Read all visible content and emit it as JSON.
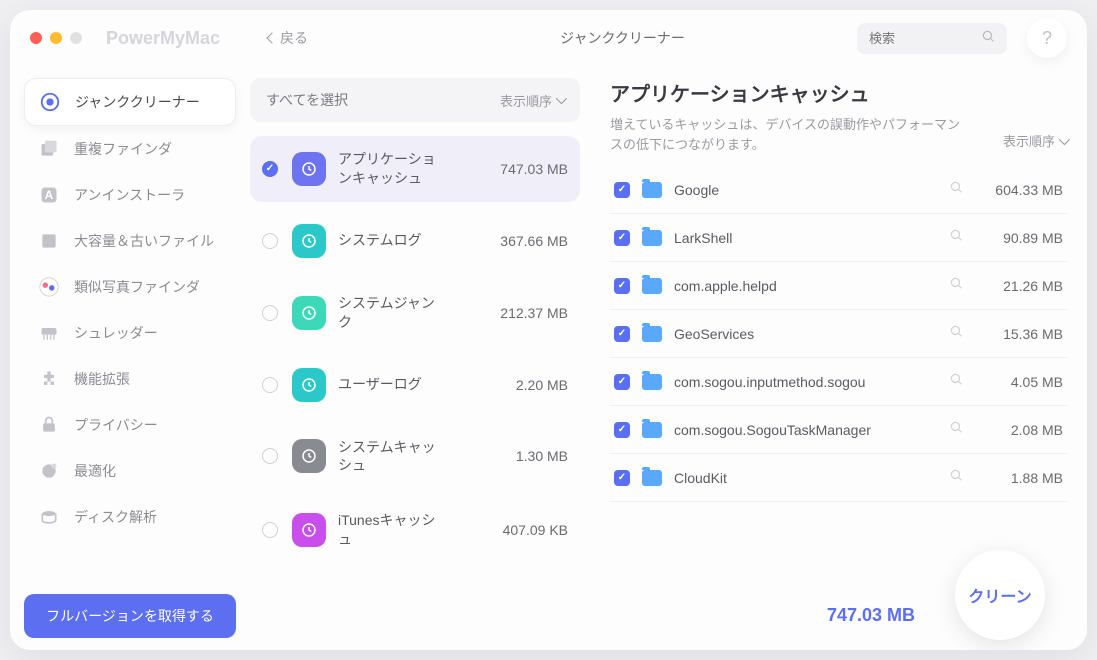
{
  "brand": "PowerMyMac",
  "back_label": "戻る",
  "top_title": "ジャンククリーナー",
  "search_placeholder": "検索",
  "help_label": "?",
  "sidebar": {
    "items": [
      {
        "label": "ジャンククリーナー",
        "icon": "junk-cleaner-icon",
        "active": true
      },
      {
        "label": "重複ファインダ",
        "icon": "duplicate-finder-icon"
      },
      {
        "label": "アンインストーラ",
        "icon": "uninstaller-icon"
      },
      {
        "label": "大容量＆古いファイル",
        "icon": "large-old-files-icon"
      },
      {
        "label": "類似写真ファインダ",
        "icon": "similar-photos-icon"
      },
      {
        "label": "シュレッダー",
        "icon": "shredder-icon"
      },
      {
        "label": "機能拡張",
        "icon": "extensions-icon"
      },
      {
        "label": "プライバシー",
        "icon": "privacy-icon"
      },
      {
        "label": "最適化",
        "icon": "optimize-icon"
      },
      {
        "label": "ディスク解析",
        "icon": "disk-analyze-icon"
      }
    ],
    "full_version_label": "フルバージョンを取得する"
  },
  "middle": {
    "select_all_label": "すべてを選択",
    "sort_label": "表示順序",
    "categories": [
      {
        "label": "アプリケーションキャッシュ",
        "size": "747.03 MB",
        "checked": true,
        "active": true,
        "color": "#6e74ef"
      },
      {
        "label": "システムログ",
        "size": "367.66 MB",
        "checked": false,
        "color": "#2ac8c8"
      },
      {
        "label": "システムジャンク",
        "size": "212.37 MB",
        "checked": false,
        "color": "#3dd8b8"
      },
      {
        "label": "ユーザーログ",
        "size": "2.20 MB",
        "checked": false,
        "color": "#2ac8c8"
      },
      {
        "label": "システムキャッシュ",
        "size": "1.30 MB",
        "checked": false,
        "color": "#8a8a92"
      },
      {
        "label": "iTunesキャッシュ",
        "size": "407.09 KB",
        "checked": false,
        "color": "#c94eeb"
      }
    ]
  },
  "detail": {
    "title": "アプリケーションキャッシュ",
    "subtitle": "増えているキャッシュは、デバイスの誤動作やパフォーマンスの低下につながります。",
    "sort_label": "表示順序",
    "files": [
      {
        "name": "Google",
        "size": "604.33 MB"
      },
      {
        "name": "LarkShell",
        "size": "90.89 MB"
      },
      {
        "name": "com.apple.helpd",
        "size": "21.26 MB"
      },
      {
        "name": "GeoServices",
        "size": "15.36 MB"
      },
      {
        "name": "com.sogou.inputmethod.sogou",
        "size": "4.05 MB"
      },
      {
        "name": "com.sogou.SogouTaskManager",
        "size": "2.08 MB"
      },
      {
        "name": "CloudKit",
        "size": "1.88 MB"
      }
    ]
  },
  "footer": {
    "total_size": "747.03 MB",
    "clean_label": "クリーン"
  }
}
